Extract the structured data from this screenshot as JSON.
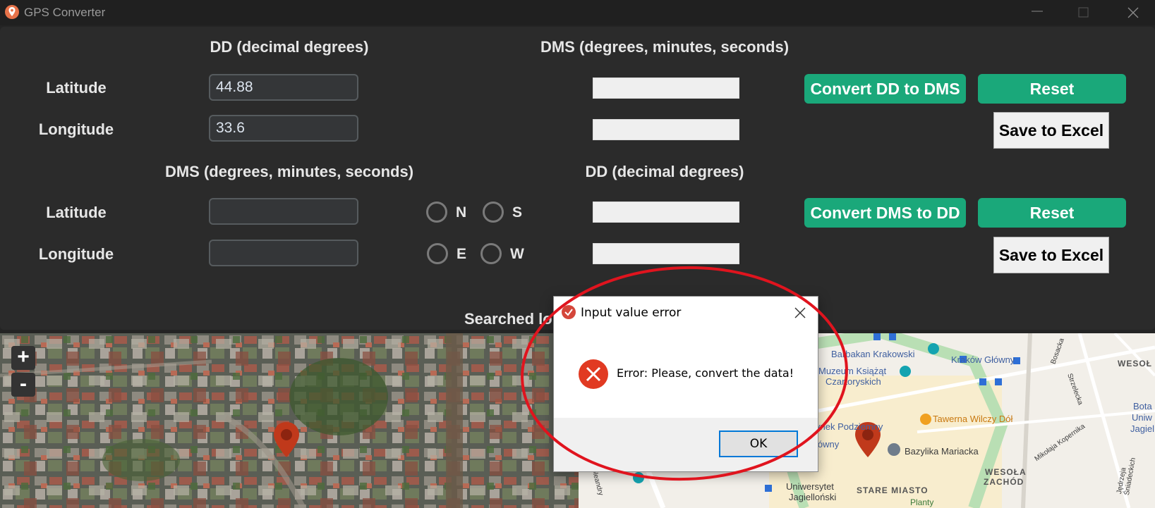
{
  "window": {
    "title": "GPS Converter",
    "icon": "map-pin-icon"
  },
  "dd_to_dms": {
    "input_heading": "DD (decimal degrees)",
    "output_heading": "DMS (degrees, minutes, seconds)",
    "latitude_label": "Latitude",
    "longitude_label": "Longitude",
    "latitude_value": "44.88",
    "longitude_value": "33.6",
    "convert_label": "Convert DD to DMS",
    "reset_label": "Reset",
    "save_label": "Save to Excel"
  },
  "dms_to_dd": {
    "input_heading": "DMS (degrees, minutes, seconds)",
    "output_heading": "DD (decimal degrees)",
    "latitude_label": "Latitude",
    "longitude_label": "Longitude",
    "lat_dirs": [
      "N",
      "S"
    ],
    "lon_dirs": [
      "E",
      "W"
    ],
    "convert_label": "Convert DMS to DD",
    "reset_label": "Reset",
    "save_label": "Save to Excel"
  },
  "searched_label": "Searched lo",
  "map": {
    "zoom_in": "+",
    "zoom_out": "-",
    "labels": {
      "barbakan": "Barbakan Krakowski",
      "krakow_glowny": "Kraków Główny",
      "muzeum1": "Muzeum Książąt",
      "muzeum2": "Czartoryskich",
      "tawerna": "Tawerna Wilczy Dół",
      "podziemny": "ynek Podziemny",
      "glowny": "łówny",
      "bazylika": "Bazylika Mariacka",
      "uniwersytet1": "Uniwersytet",
      "uniwersytet2": "Jagielloński",
      "stare_miasto": "STARE MIASTO",
      "wesola_zachod1": "WESOŁA",
      "wesola_zachod2": "ZACHÓD",
      "wesol": "WESOŁ",
      "bota": "Bota",
      "uniw": "Uniw",
      "jagiel": "Jagiel",
      "kopernika": "Mikołaja Kopernika",
      "strzelecka": "Strzelecka",
      "bosacka": "Bosacka",
      "oleandry": "Oleandry",
      "sniadeckich": "Jędrzeja Śniadeckich",
      "planty": "Planty"
    }
  },
  "dialog": {
    "title": "Input value error",
    "message": "Error: Please, convert the data!",
    "ok_label": "OK",
    "icon": "error-icon"
  },
  "colors": {
    "background": "#242424",
    "panel": "#2b2b2b",
    "accent_green": "#1aa87a",
    "annotation_red": "#e0141e",
    "pin": "#c0391b"
  }
}
